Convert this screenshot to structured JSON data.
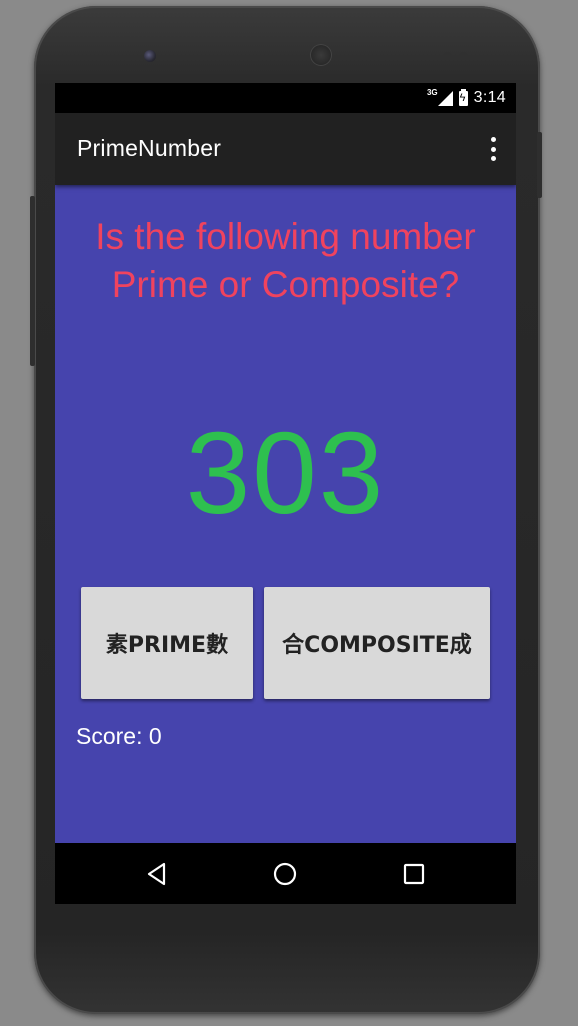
{
  "status_bar": {
    "network": "3G",
    "time": "3:14"
  },
  "app_bar": {
    "title": "PrimeNumber",
    "overflow_icon": "more-vert-icon"
  },
  "main": {
    "question": "Is the following number Prime or Composite?",
    "number": "303",
    "prime_button_label": "素PRIME數",
    "composite_button_label": "合COMPOSITE成",
    "score_text": "Score: 0"
  },
  "nav_bar": {
    "back_icon": "back-triangle-icon",
    "home_icon": "home-circle-icon",
    "recents_icon": "recents-square-icon"
  },
  "colors": {
    "content_background": "#4644ad",
    "question_text": "#f0435e",
    "number_text": "#2ec04f",
    "app_bar": "#212121",
    "button_background": "#d9d9d9"
  }
}
